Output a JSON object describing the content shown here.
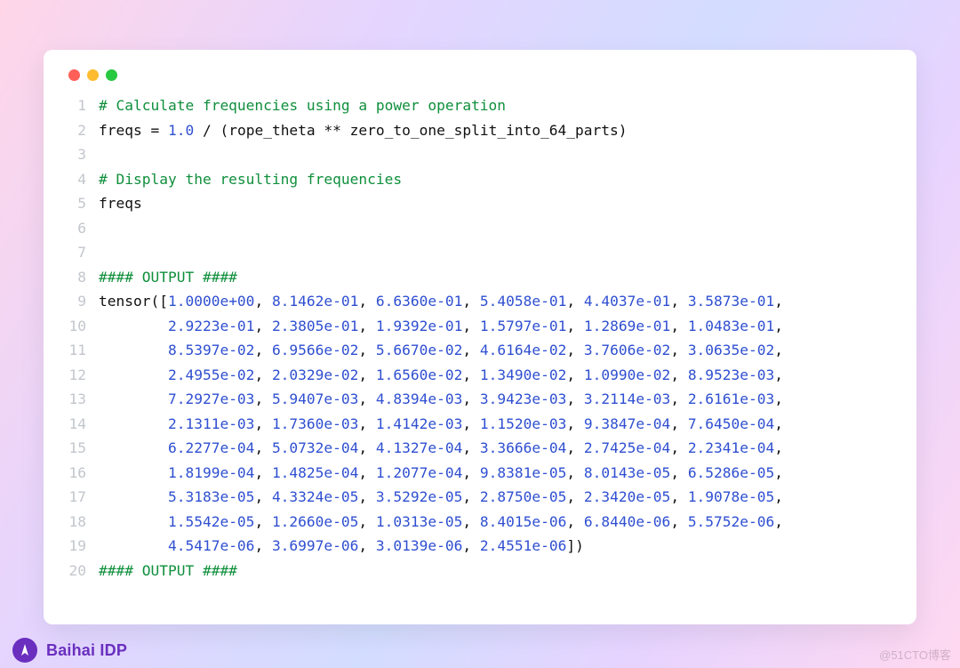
{
  "footer": {
    "brand": "Baihai IDP"
  },
  "watermark": "@51CTO博客",
  "code": {
    "line1_comment": "# Calculate frequencies using a power operation",
    "line2_lhs": "freqs ",
    "line2_eq": "= ",
    "line2_num": "1.0",
    "line2_rest": " / (rope_theta ** zero_to_one_split_into_64_parts)",
    "line4_comment": "# Display the resulting frequencies",
    "line5": "freqs",
    "line8_outhdr": "#### OUTPUT ####",
    "line9_prefix": "tensor([",
    "line20_outhdr": "#### OUTPUT ####",
    "tensor_rows": [
      [
        "1.0000e+00",
        "8.1462e-01",
        "6.6360e-01",
        "5.4058e-01",
        "4.4037e-01",
        "3.5873e-01"
      ],
      [
        "2.9223e-01",
        "2.3805e-01",
        "1.9392e-01",
        "1.5797e-01",
        "1.2869e-01",
        "1.0483e-01"
      ],
      [
        "8.5397e-02",
        "6.9566e-02",
        "5.6670e-02",
        "4.6164e-02",
        "3.7606e-02",
        "3.0635e-02"
      ],
      [
        "2.4955e-02",
        "2.0329e-02",
        "1.6560e-02",
        "1.3490e-02",
        "1.0990e-02",
        "8.9523e-03"
      ],
      [
        "7.2927e-03",
        "5.9407e-03",
        "4.8394e-03",
        "3.9423e-03",
        "3.2114e-03",
        "2.6161e-03"
      ],
      [
        "2.1311e-03",
        "1.7360e-03",
        "1.4142e-03",
        "1.1520e-03",
        "9.3847e-04",
        "7.6450e-04"
      ],
      [
        "6.2277e-04",
        "5.0732e-04",
        "4.1327e-04",
        "3.3666e-04",
        "2.7425e-04",
        "2.2341e-04"
      ],
      [
        "1.8199e-04",
        "1.4825e-04",
        "1.2077e-04",
        "9.8381e-05",
        "8.0143e-05",
        "6.5286e-05"
      ],
      [
        "5.3183e-05",
        "4.3324e-05",
        "3.5292e-05",
        "2.8750e-05",
        "2.3420e-05",
        "1.9078e-05"
      ],
      [
        "1.5542e-05",
        "1.2660e-05",
        "1.0313e-05",
        "8.4015e-06",
        "6.8440e-06",
        "5.5752e-06"
      ],
      [
        "4.5417e-06",
        "3.6997e-06",
        "3.0139e-06",
        "2.4551e-06"
      ]
    ]
  }
}
